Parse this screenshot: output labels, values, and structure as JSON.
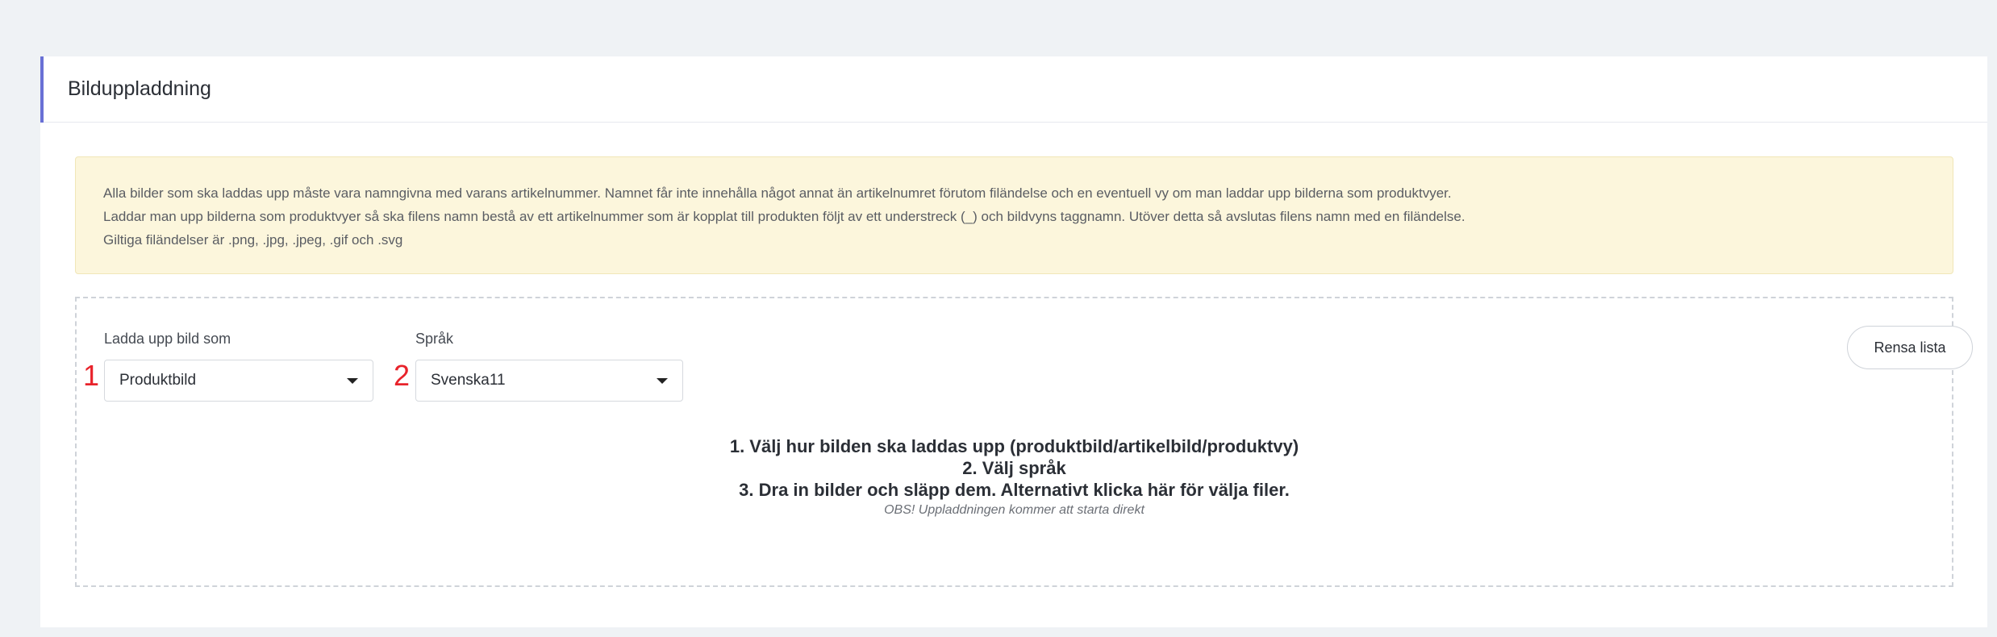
{
  "card": {
    "title": "Bilduppladdning"
  },
  "info": {
    "lines": [
      "Alla bilder som ska laddas upp måste vara namngivna med varans artikelnummer. Namnet får inte innehålla något annat än artikelnumret förutom filändelse och en eventuell vy om man laddar upp bilderna som produktvyer.",
      "Laddar man upp bilderna som produktvyer så ska filens namn bestå av ett artikelnummer som är kopplat till produkten följt av ett understreck (_) och bildvyns taggnamn. Utöver detta så avslutas filens namn med en filändelse.",
      "Giltiga filändelser är .png, .jpg, .jpeg, .gif och .svg"
    ]
  },
  "upload_type": {
    "label": "Ladda upp bild som",
    "marker": "1",
    "selected": "Produktbild"
  },
  "language": {
    "label": "Språk",
    "marker": "2",
    "selected": "Svenska11"
  },
  "clear_button": {
    "label": "Rensa lista"
  },
  "instructions": {
    "lines": [
      "1. Välj hur bilden ska laddas upp (produktbild/artikelbild/produktvy)",
      "2. Välj språk",
      "3. Dra in bilder och släpp dem. Alternativt klicka här för välja filer."
    ],
    "note": "OBS! Uppladdningen kommer att starta direkt"
  },
  "colors": {
    "accent": "#6970d5",
    "info_background": "#fcf6dc",
    "marker": "#e8232b"
  }
}
